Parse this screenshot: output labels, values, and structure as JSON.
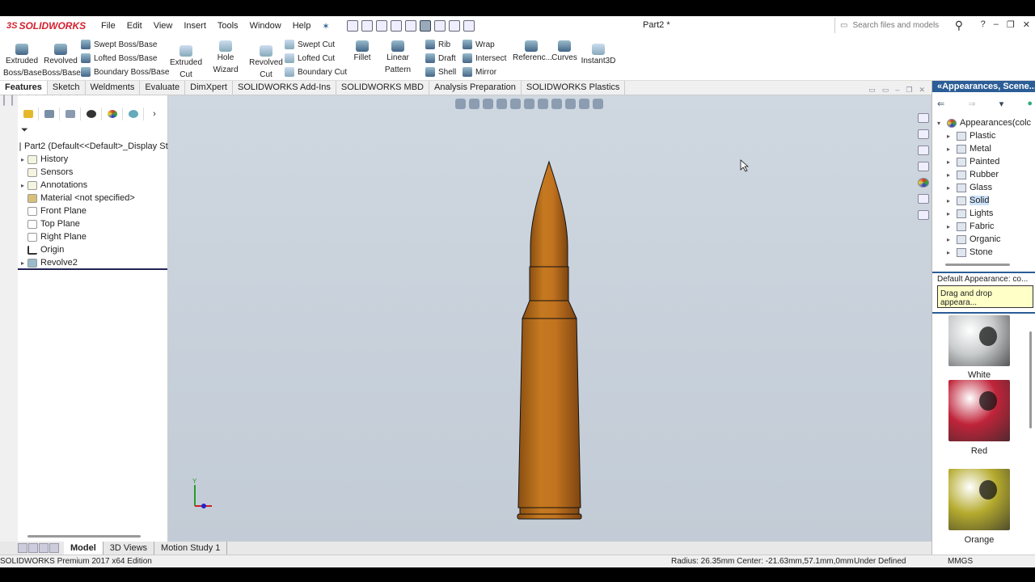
{
  "app": {
    "logo_text": "SOLIDWORKS",
    "doc_title": "Part2 *"
  },
  "menu": [
    "File",
    "Edit",
    "View",
    "Insert",
    "Tools",
    "Window",
    "Help"
  ],
  "search": {
    "placeholder": "Search files and models"
  },
  "ribbon": {
    "extruded_boss": "Extruded Boss/Base",
    "revolved_boss": "Revolved Boss/Base",
    "swept_boss": "Swept Boss/Base",
    "lofted_boss": "Lofted Boss/Base",
    "boundary_boss": "Boundary Boss/Base",
    "extruded_cut": "Extruded Cut",
    "hole_wizard": "Hole Wizard",
    "revolved_cut": "Revolved Cut",
    "swept_cut": "Swept Cut",
    "lofted_cut": "Lofted Cut",
    "boundary_cut": "Boundary Cut",
    "fillet": "Fillet",
    "linear_pattern": "Linear Pattern",
    "rib": "Rib",
    "draft": "Draft",
    "shell": "Shell",
    "wrap": "Wrap",
    "intersect": "Intersect",
    "mirror": "Mirror",
    "reference": "Referenc...",
    "curves": "Curves",
    "instant3d": "Instant3D"
  },
  "tabs": [
    "Features",
    "Sketch",
    "Weldments",
    "Evaluate",
    "DimXpert",
    "SOLIDWORKS Add-Ins",
    "SOLIDWORKS MBD",
    "Analysis Preparation",
    "SOLIDWORKS Plastics"
  ],
  "tree": {
    "root": "Part2  (Default<<Default>_Display Sta",
    "items": [
      "History",
      "Sensors",
      "Annotations",
      "Material <not specified>",
      "Front Plane",
      "Top Plane",
      "Right Plane",
      "Origin",
      "Revolve2"
    ]
  },
  "bottom_tabs": [
    "Model",
    "3D Views",
    "Motion Study 1"
  ],
  "status": {
    "edition": "SOLIDWORKS Premium 2017 x64 Edition",
    "readout": "Radius: 26.35mm  Center: -21.63mm,57.1mm,0mm",
    "state": "Under Defined",
    "units": "MMGS"
  },
  "appearances": {
    "header": "«Appearances, Scene...",
    "root": "Appearances(colc",
    "folders": [
      "Plastic",
      "Metal",
      "Painted",
      "Rubber",
      "Glass",
      "Solid",
      "Lights",
      "Fabric",
      "Organic",
      "Stone"
    ],
    "selected": "Solid",
    "default_label": "Default Appearance: co...",
    "tip": "Drag and drop appeara...",
    "swatches": [
      {
        "name": "White",
        "color": "#c8cbcc"
      },
      {
        "name": "Red",
        "color": "#c0243a"
      },
      {
        "name": "Orange",
        "color": "#b5ab2e"
      }
    ]
  },
  "model": {
    "color": "#c2731f"
  }
}
